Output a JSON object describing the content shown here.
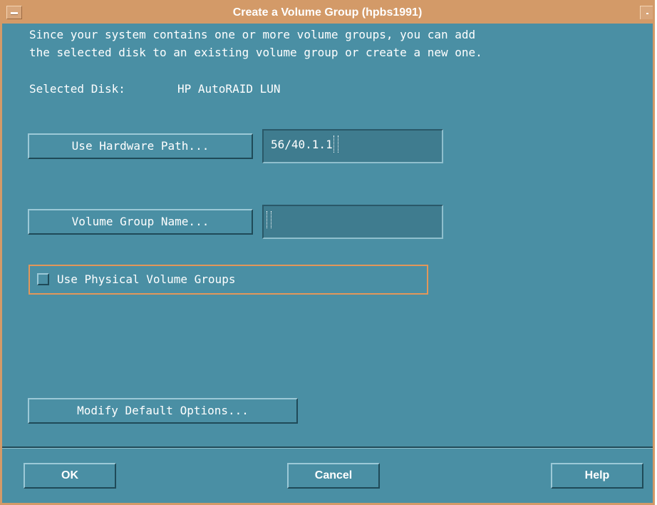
{
  "window": {
    "title": "Create a Volume Group (hpbs1991)"
  },
  "intro": {
    "line1": "Since your system contains one or more volume groups, you can add",
    "line2": "the selected disk to an existing volume group or create a new one."
  },
  "selected_disk": {
    "label": "Selected Disk:",
    "value": "HP AutoRAID LUN"
  },
  "hardware_path": {
    "button_label": "Use Hardware Path...",
    "value": "56/40.1.1"
  },
  "volume_group": {
    "button_label": "Volume Group Name...",
    "value": ""
  },
  "physical_volume_groups": {
    "label": "Use Physical Volume Groups",
    "checked": false
  },
  "modify_defaults": {
    "button_label": "Modify Default Options..."
  },
  "actions": {
    "ok": "OK",
    "cancel": "Cancel",
    "help": "Help"
  },
  "colors": {
    "dialog_bg": "#4a8fa4",
    "titlebar": "#d39a68",
    "focus_border": "#e2975a",
    "text": "#ffffff"
  },
  "icons": [
    "window-menu-icon",
    "minimize-icon"
  ]
}
